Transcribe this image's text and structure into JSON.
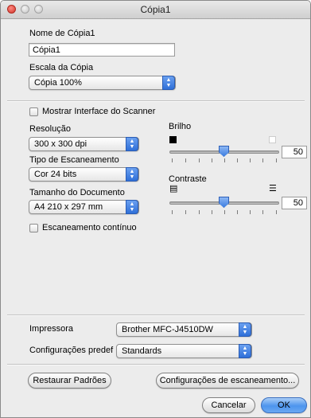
{
  "window": {
    "title": "Cópia1"
  },
  "name_section": {
    "name_label": "Nome de Cópia1",
    "name_value": "Cópia1",
    "scale_label": "Escala da Cópia",
    "scale_value": "Cópia 100%"
  },
  "scanner": {
    "show_interface_label": "Mostrar Interface do Scanner",
    "resolution_label": "Resolução",
    "resolution_value": "300 x 300 dpi",
    "scan_type_label": "Tipo de Escaneamento",
    "scan_type_value": "Cor 24 bits",
    "doc_size_label": "Tamanho do Documento",
    "doc_size_value": "A4 210 x 297 mm",
    "continuous_label": "Escaneamento contínuo",
    "brightness_label": "Brilho",
    "brightness_value": "50",
    "contrast_label": "Contraste",
    "contrast_value": "50"
  },
  "printer": {
    "printer_label": "Impressora",
    "printer_value": "Brother MFC-J4510DW",
    "settings_label": "Configurações predef",
    "settings_value": "Standards"
  },
  "buttons": {
    "restore": "Restaurar Padrões",
    "scan_settings": "Configurações de escaneamento...",
    "cancel": "Cancelar",
    "ok": "OK"
  },
  "icons": {
    "popup_arrows": "◆"
  },
  "colors": {
    "accent": "#3e7ee0",
    "window_bg": "#ececec"
  }
}
